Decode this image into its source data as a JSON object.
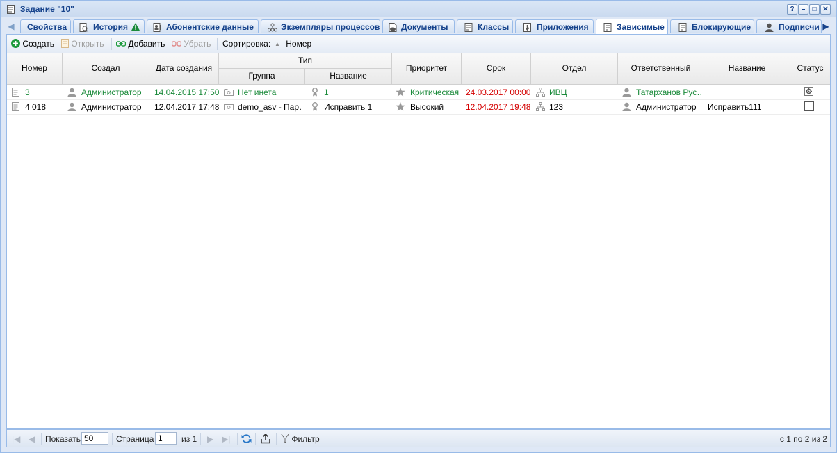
{
  "window": {
    "title": "Задание \"10\""
  },
  "window_buttons": [
    "?",
    "–",
    "□",
    "✕"
  ],
  "tabs": [
    {
      "label": "Свойства",
      "icon": "none",
      "active": false
    },
    {
      "label": "История",
      "icon": "history-icon",
      "active": false
    },
    {
      "label": "Абонентские данные",
      "icon": "contact-card-icon",
      "active": false
    },
    {
      "label": "Экземпляры процессов",
      "icon": "process-icon",
      "active": false
    },
    {
      "label": "Документы",
      "icon": "document-icon",
      "active": false
    },
    {
      "label": "Классы",
      "icon": "class-icon",
      "active": false
    },
    {
      "label": "Приложения",
      "icon": "attachment-icon",
      "active": false
    },
    {
      "label": "Зависимые",
      "icon": "task-icon",
      "active": true
    },
    {
      "label": "Блокирующие",
      "icon": "task-icon",
      "active": false
    },
    {
      "label": "Подписчи",
      "icon": "user-icon",
      "active": false
    }
  ],
  "toolbar": {
    "create": "Создать",
    "open": "Открыть",
    "add": "Добавить",
    "remove": "Убрать",
    "sort_label": "Сортировка:",
    "sort_field": "Номер"
  },
  "grid": {
    "headers": {
      "number": "Номер",
      "creator": "Создал",
      "created": "Дата создания",
      "type": "Тип",
      "group": "Группа",
      "type_name": "Название",
      "priority": "Приоритет",
      "deadline": "Срок",
      "department": "Отдел",
      "responsible": "Ответственный",
      "name": "Название",
      "status": "Статус"
    },
    "rows": [
      {
        "number": "3",
        "creator": "Администратор",
        "created": "14.04.2015 17:50",
        "group": "Нет инета",
        "type_name": "1",
        "priority": "Критическая",
        "deadline": "24.03.2017 00:00",
        "department": "ИВЦ",
        "responsible": "Татарханов Рус…",
        "name": "",
        "status": "gear"
      },
      {
        "number": "4 018",
        "creator": "Администратор",
        "created": "12.04.2017 17:48",
        "group": "demo_asv - Пар…",
        "type_name": "Исправить 1",
        "priority": "Высокий",
        "deadline": "12.04.2017 19:48",
        "department": "123",
        "responsible": "Администратор",
        "name": "Исправить111",
        "status": "empty"
      }
    ]
  },
  "pager": {
    "show_label": "Показать",
    "page_size": "50",
    "page_label": "Страница",
    "page": "1",
    "of_label": "из 1",
    "filter_label": "Фильтр",
    "summary": "с 1 по 2 из 2"
  },
  "colors": {
    "accent": "#15428b",
    "green": "#1a8a3a",
    "red": "#d40000"
  }
}
